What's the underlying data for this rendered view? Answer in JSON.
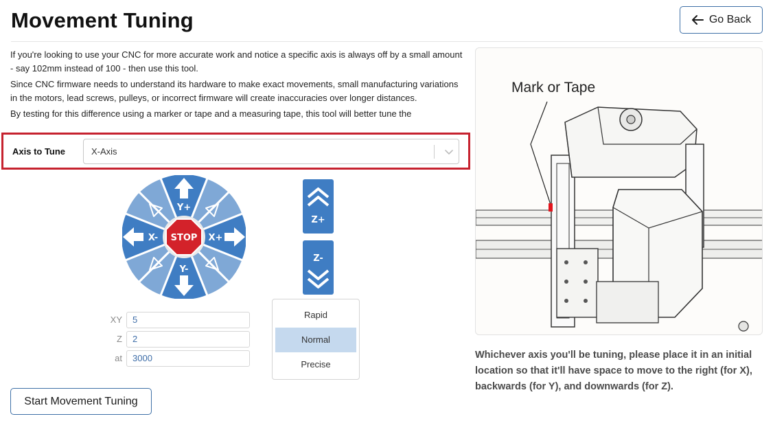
{
  "header": {
    "title": "Movement Tuning",
    "back_label": "Go Back"
  },
  "intro": {
    "paragraphs": [
      "If you're looking to use your CNC for more accurate work and notice a specific axis is always off by a small amount - say 102mm instead of 100 - then use this tool.",
      "Since CNC firmware needs to understand its hardware to make exact movements, small manufacturing variations in the motors, lead screws, pulleys, or incorrect firmware will create inaccuracies over longer distances.",
      "By testing for this difference using a marker or tape and a measuring tape, this tool will better tune the"
    ]
  },
  "axis": {
    "label": "Axis to Tune",
    "selected": "X-Axis",
    "highlight_color": "#c6222f"
  },
  "jog": {
    "stop_label": "STOP",
    "y_plus": "Y+",
    "y_minus": "Y-",
    "x_plus": "X+",
    "x_minus": "X-",
    "z_plus": "Z+",
    "z_minus": "Z-",
    "button_color": "#3f7dc3",
    "stop_color": "#d3222a"
  },
  "steps": {
    "xy_label": "XY",
    "xy_value": "5",
    "z_label": "Z",
    "z_value": "2",
    "feed_label": "at",
    "feed_value": "3000"
  },
  "speed": {
    "options": [
      "Rapid",
      "Normal",
      "Precise"
    ],
    "selected": "Normal"
  },
  "actions": {
    "start_label": "Start Movement Tuning"
  },
  "illustration": {
    "label": "Mark or Tape",
    "mark_color": "#e3141c"
  },
  "instructions": "Whichever axis you'll be tuning, please place it in an initial location so that it'll have space to move to the right (for X), backwards (for Y), and downwards (for Z)."
}
